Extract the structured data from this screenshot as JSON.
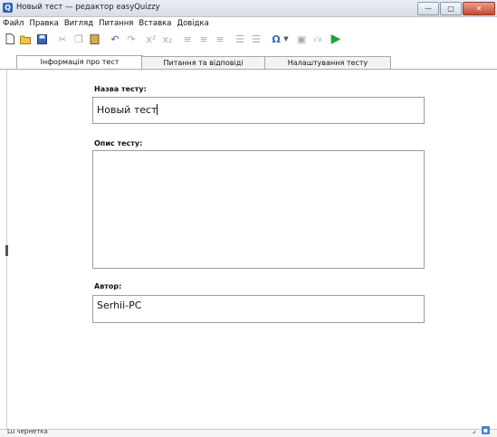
{
  "window": {
    "title": "Новый тест — редактор easyQuizzy",
    "app_icon_letter": "Q"
  },
  "menu": [
    "Файл",
    "Правка",
    "Вигляд",
    "Питання",
    "Вставка",
    "Довідка"
  ],
  "toolbar": {
    "icons": [
      "new-document-icon",
      "open-folder-icon",
      "save-icon",
      "cut-icon",
      "copy-icon",
      "paste-icon",
      "undo-icon",
      "redo-icon",
      "superscript-icon",
      "subscript-icon",
      "align-left-icon",
      "align-center-icon",
      "align-right-icon",
      "numbered-list-icon",
      "bulleted-list-icon",
      "special-character-icon",
      "dropdown-arrow-icon",
      "insert-image-icon",
      "insert-formula-icon",
      "run-test-icon"
    ],
    "glyphs": {
      "omega": "Ω",
      "superscript": "x²",
      "subscript": "x₂",
      "formula": "√x",
      "play": "▶"
    }
  },
  "tabs": [
    {
      "label": "Інформація про тест",
      "active": true
    },
    {
      "label": "Питання та відповіді",
      "active": false
    },
    {
      "label": "Налаштування тесту",
      "active": false
    }
  ],
  "form": {
    "title_label": "Назва тесту:",
    "title_value": "Новый тест",
    "description_label": "Опис тесту:",
    "description_value": "",
    "author_label": "Автор:",
    "author_value": "Serhii-PC"
  },
  "status": {
    "text": "Lu чернетка"
  },
  "colors": {
    "accent_blue": "#2f63b8",
    "run_green": "#1fa23a",
    "close_red": "#c8452d"
  }
}
